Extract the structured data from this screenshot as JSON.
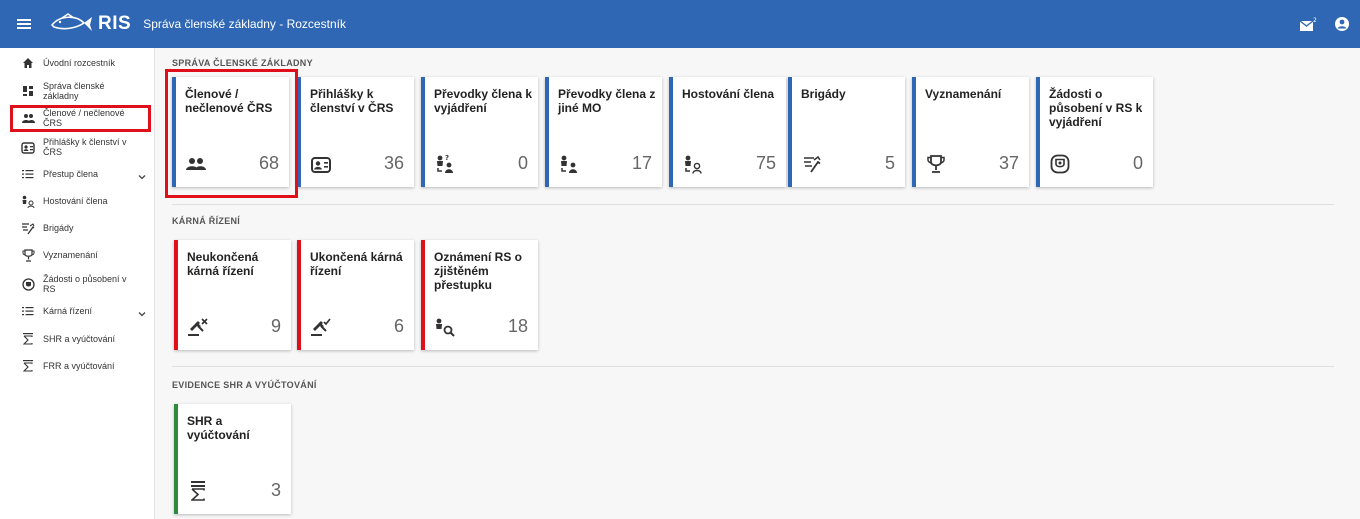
{
  "header": {
    "logo_text": "RIS",
    "app_title": "Správa členské základny - Rozcestník"
  },
  "sidebar": {
    "items": [
      {
        "label": "Úvodní rozcestník",
        "icon": "home-icon"
      },
      {
        "label": "Správa členské základny",
        "icon": "dashboard-icon"
      },
      {
        "label": "Členové / nečlenové ČRS",
        "icon": "people-icon"
      },
      {
        "label": "Přihlášky k členství v ČRS",
        "icon": "id-card-icon"
      },
      {
        "label": "Přestup člena",
        "icon": "list-icon"
      },
      {
        "label": "Hostování člena",
        "icon": "person-hosting-icon"
      },
      {
        "label": "Brigády",
        "icon": "brigade-icon"
      },
      {
        "label": "Vyznamenání",
        "icon": "trophy-icon"
      },
      {
        "label": "Žádosti o působení v RS",
        "icon": "shield-request-icon"
      },
      {
        "label": "Kárná řízení",
        "icon": "list-icon"
      },
      {
        "label": "SHR a vyúčtování",
        "icon": "sum-icon"
      },
      {
        "label": "FRR a vyúčtování",
        "icon": "sum-icon"
      }
    ]
  },
  "sections": [
    {
      "title": "SPRÁVA ČLENSKÉ ZÁKLADNY",
      "tiles": [
        {
          "title": "Členové / nečlenové ČRS",
          "count": "68",
          "icon": "people-icon"
        },
        {
          "title": "Přihlášky k členství v ČRS",
          "count": "36",
          "icon": "id-card-icon"
        },
        {
          "title": "Převodky člena k vyjádření",
          "count": "0",
          "icon": "transfer-question-icon"
        },
        {
          "title": "Převodky člena z jiné MO",
          "count": "17",
          "icon": "transfer-icon"
        },
        {
          "title": "Hostování člena",
          "count": "75",
          "icon": "person-hosting-icon"
        },
        {
          "title": "Brigády",
          "count": "5",
          "icon": "brigade-icon"
        },
        {
          "title": "Vyznamenání",
          "count": "37",
          "icon": "trophy-icon"
        },
        {
          "title": "Žádosti o působení v RS k vyjádření",
          "count": "0",
          "icon": "shield-request-icon"
        }
      ]
    },
    {
      "title": "KÁRNÁ ŘÍZENÍ",
      "tiles": [
        {
          "title": "Neukončená kárná řízení",
          "count": "9",
          "icon": "gavel-x-icon"
        },
        {
          "title": "Ukončená kárná řízení",
          "count": "6",
          "icon": "gavel-check-icon"
        },
        {
          "title": "Oznámení RS o zjištěném přestupku",
          "count": "18",
          "icon": "person-search-icon"
        }
      ]
    },
    {
      "title": "EVIDENCE SHR A VYÚČTOVÁNÍ",
      "tiles": [
        {
          "title": "SHR a vyúčtování",
          "count": "3",
          "icon": "sum-icon"
        }
      ]
    }
  ],
  "colors": {
    "topbar": "#2f67b5",
    "accent_blue": "#2f67b5",
    "accent_red": "#e0101a",
    "accent_green": "#2e8b3e",
    "highlight": "#e0101a"
  }
}
